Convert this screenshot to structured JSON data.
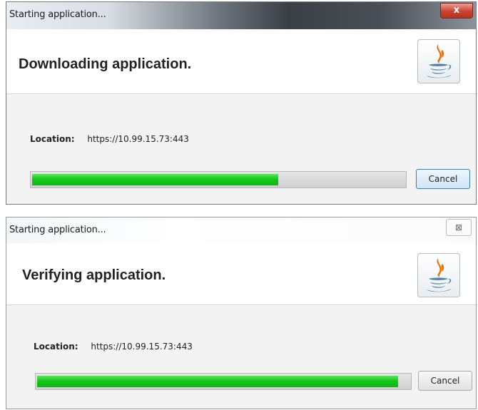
{
  "dialogs": [
    {
      "title": "Starting application...",
      "close_label": "x",
      "heading": "Downloading application.",
      "location_label": "Location:",
      "location_value": "https://10.99.15.73:443",
      "progress_fraction": 0.66,
      "cancel_label": "Cancel",
      "logo_icon": "java-icon"
    },
    {
      "title": "Starting application...",
      "close_label": "⊠",
      "heading": "Verifying application.",
      "location_label": "Location:",
      "location_value": "https://10.99.15.73:443",
      "progress_fraction": 0.97,
      "cancel_label": "Cancel",
      "logo_icon": "java-icon"
    }
  ],
  "colors": {
    "progress_green": "#15c81a",
    "java_orange": "#e76f00",
    "java_blue": "#5382a1"
  }
}
